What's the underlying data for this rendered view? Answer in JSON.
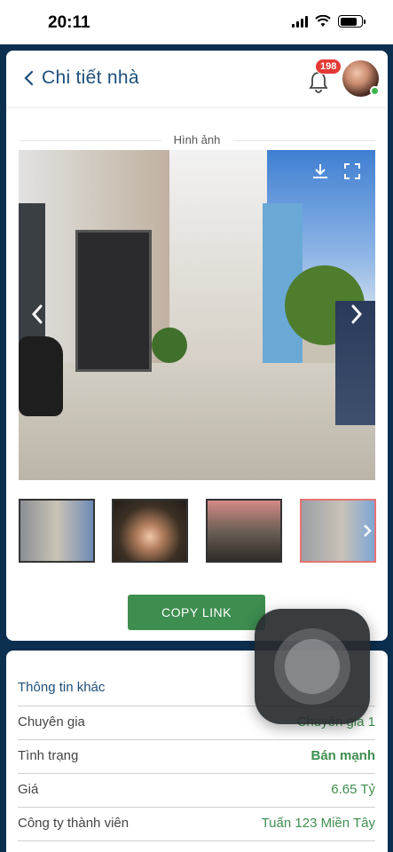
{
  "status_bar": {
    "time": "20:11"
  },
  "header": {
    "title": "Chi tiết nhà",
    "notification_count": "198"
  },
  "gallery": {
    "section_label": "Hình ảnh",
    "thumbnail_count": 4,
    "active_thumbnail": 4
  },
  "actions": {
    "copy_link_label": "COPY LINK"
  },
  "info": {
    "title": "Thông tin khác",
    "rows": [
      {
        "label": "Chuyên gia",
        "value": "Chuyên gia 1"
      },
      {
        "label": "Tình trạng",
        "value": "Bán mạnh"
      },
      {
        "label": "Giá",
        "value": "6.65 Tỷ"
      },
      {
        "label": "Công ty thành viên",
        "value": "Tuấn 123 Miền Tây"
      }
    ]
  },
  "colors": {
    "navy": "#0d2f4f",
    "title_blue": "#1d4e7a",
    "accent_green": "#3e8e4f",
    "badge_red": "#e53935"
  },
  "icons": [
    "back-chevron-icon",
    "bell-icon",
    "download-icon",
    "fullscreen-icon",
    "chevron-left-icon",
    "chevron-right-icon"
  ]
}
